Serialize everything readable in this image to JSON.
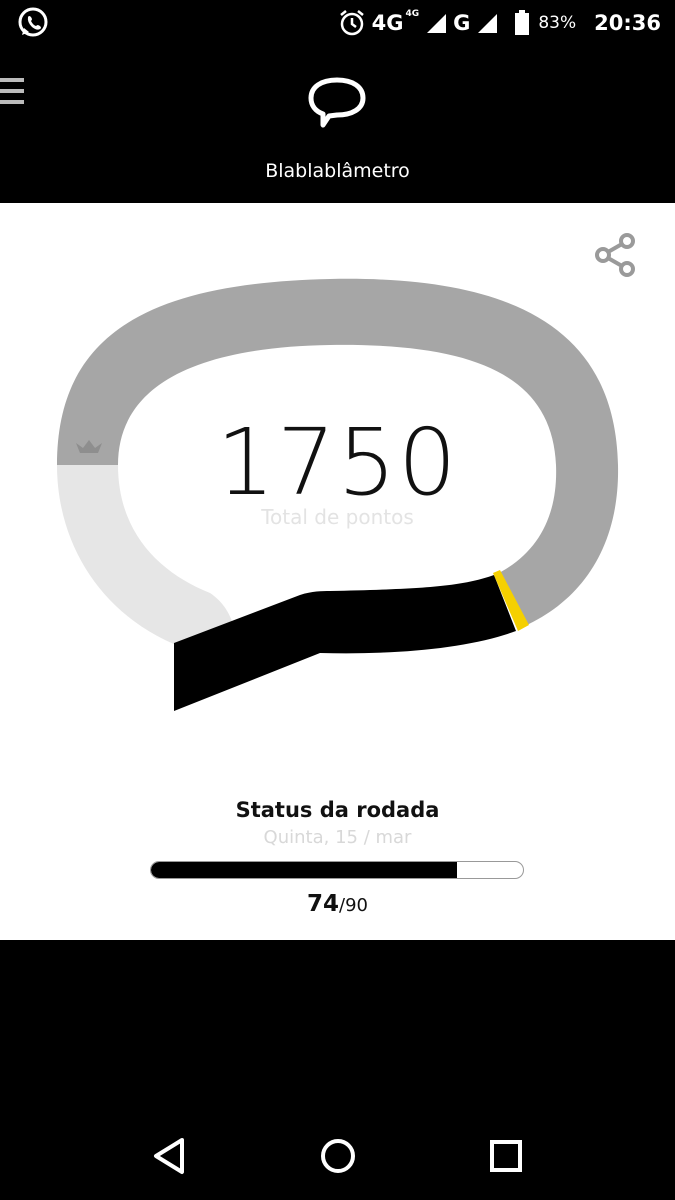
{
  "status_bar": {
    "network_primary": "4G",
    "network_small": "4G",
    "network_secondary": "G",
    "battery": "83%",
    "time": "20:36",
    "icons": [
      "whatsapp-icon",
      "alarm-icon",
      "signal-icon",
      "battery-icon"
    ]
  },
  "header": {
    "title": "Blablablâmetro",
    "icons": [
      "menu-icon",
      "speech-bubble-icon"
    ]
  },
  "meter": {
    "score": "1750",
    "score_label": "Total de pontos",
    "fraction_filled": 0.23,
    "colors": {
      "track": "#a6a6a6",
      "lower_track": "#e6e6e6",
      "fill": "#000000",
      "marker": "#f5d000"
    },
    "icons": [
      "share-icon",
      "crown-icon"
    ]
  },
  "round": {
    "title": "Status da rodada",
    "date": "Quinta, 15 / mar",
    "current": "74",
    "max": "/90",
    "progress": 0.822
  },
  "nav": {
    "icons": [
      "back-icon",
      "home-icon",
      "recents-icon"
    ]
  }
}
